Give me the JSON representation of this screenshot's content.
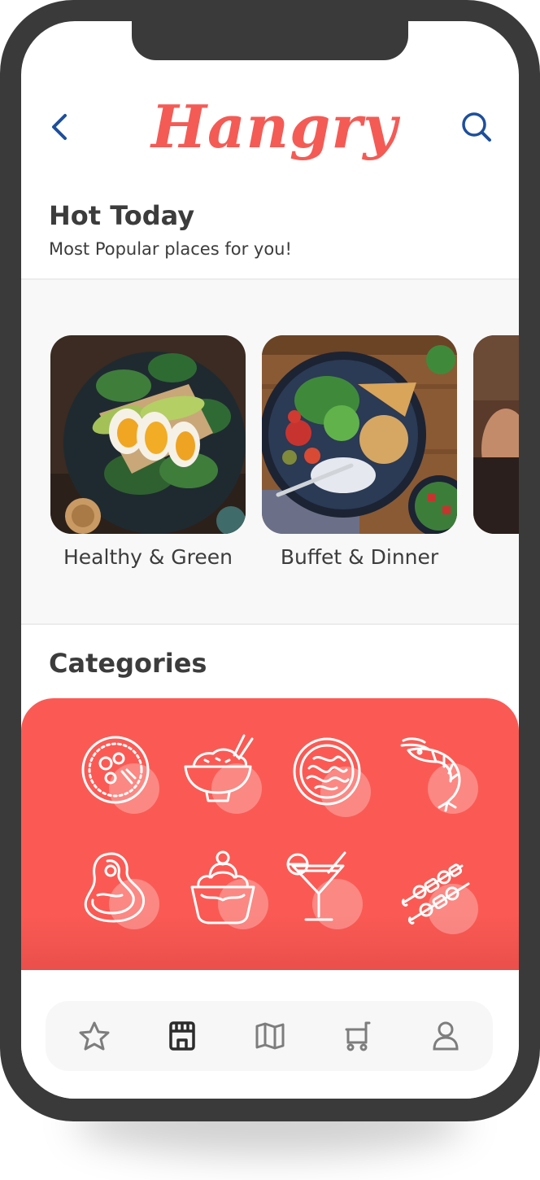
{
  "app": {
    "logo_text": "Hangry",
    "brand_color": "#f45b55",
    "accent_color": "#1d4f9c"
  },
  "header": {
    "back_icon": "chevron-left-icon",
    "search_icon": "search-icon"
  },
  "hot_today": {
    "title": "Hot Today",
    "subtitle": "Most Popular places for you!"
  },
  "featured": [
    {
      "label": "Healthy & Green",
      "image": "egg-avocado-salad-photo"
    },
    {
      "label": "Buffet & Dinner",
      "image": "salad-bowl-photo"
    },
    {
      "label": "",
      "image": "drink-photo-partial"
    }
  ],
  "categories": {
    "title": "Categories",
    "panel_color": "#fb5a54",
    "items": [
      {
        "icon": "pizza-icon"
      },
      {
        "icon": "rice-bowl-icon"
      },
      {
        "icon": "pasta-plate-icon"
      },
      {
        "icon": "shrimp-icon"
      },
      {
        "icon": "steak-icon"
      },
      {
        "icon": "cupcake-icon"
      },
      {
        "icon": "cocktail-icon"
      },
      {
        "icon": "skewer-icon"
      }
    ]
  },
  "tabbar": {
    "items": [
      {
        "icon": "star-icon",
        "active": false
      },
      {
        "icon": "store-icon",
        "active": true
      },
      {
        "icon": "map-icon",
        "active": false
      },
      {
        "icon": "cart-icon",
        "active": false
      },
      {
        "icon": "profile-icon",
        "active": false
      }
    ]
  }
}
